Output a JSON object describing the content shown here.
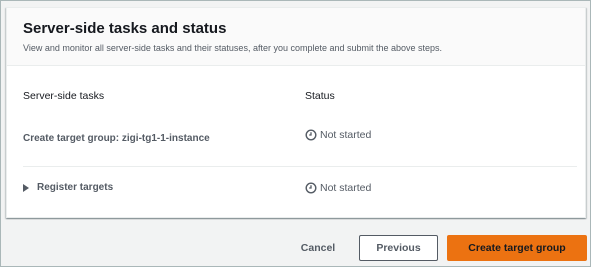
{
  "panel": {
    "title": "Server-side tasks and status",
    "description": "View and monitor all server-side tasks and their statuses, after you complete and submit the above steps."
  },
  "table": {
    "columns": [
      "Server-side tasks",
      "Status"
    ],
    "rows": [
      {
        "task": "Create target group: zigi-tg1-1-instance",
        "status": "Not started",
        "status_icon": "clock-icon",
        "expandable": false
      },
      {
        "task": "Register targets",
        "status": "Not started",
        "status_icon": "clock-icon",
        "expandable": true
      }
    ]
  },
  "footer": {
    "cancel_label": "Cancel",
    "previous_label": "Previous",
    "create_label": "Create target group"
  },
  "colors": {
    "primary_button": "#ec7211",
    "text_secondary": "#545b64",
    "page_background": "#f2f3f3"
  }
}
